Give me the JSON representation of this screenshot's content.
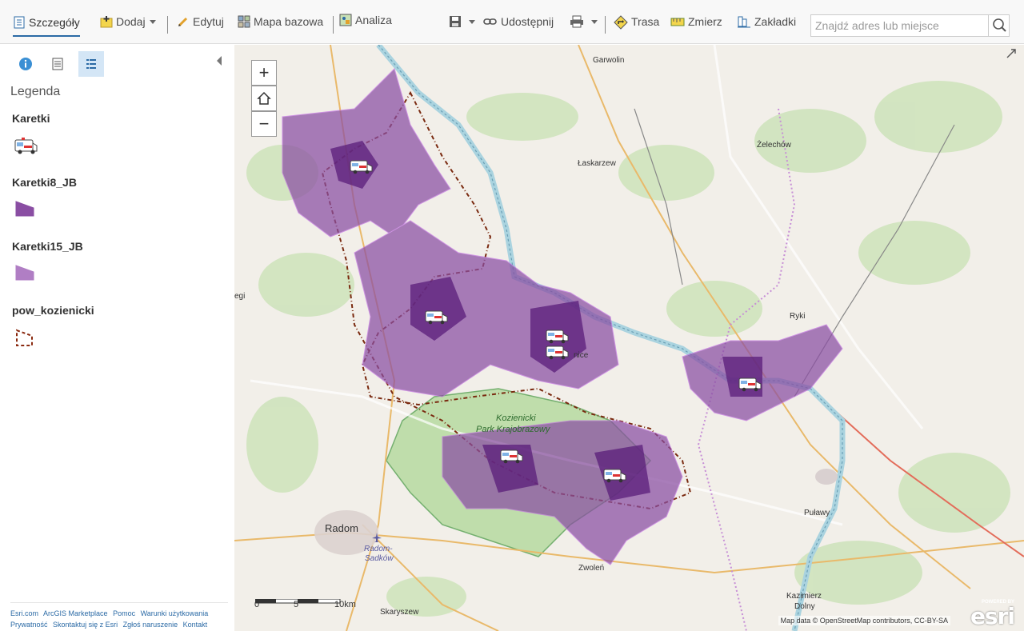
{
  "toolbar": {
    "details": "Szczegóły",
    "add": "Dodaj",
    "edit": "Edytuj",
    "basemap": "Mapa bazowa",
    "analysis": "Analiza",
    "share": "Udostępnij",
    "route": "Trasa",
    "measure": "Zmierz",
    "bookmarks": "Zakładki",
    "search_placeholder": "Znajdź adres lub miejsce"
  },
  "sidebar": {
    "legend_title": "Legenda",
    "layers": [
      "Karetki",
      "Karetki8_JB",
      "Karetki15_JB",
      "pow_kozienicki"
    ],
    "footer": [
      "Esri.com",
      "ArcGIS Marketplace",
      "Pomoc",
      "Warunki użytkowania",
      "Prywatność",
      "Skontaktuj się z Esri",
      "Zgłoś naruszenie",
      "Kontakt"
    ]
  },
  "map": {
    "places": [
      "Garwolin",
      "Łaskarzew",
      "Żelechów",
      "Ryki",
      "Kozienicki",
      "Park Krajobrazowy",
      "Radom",
      "Radom-",
      "Sadków",
      "Zwoleń",
      "Puławy",
      "Kazimierz",
      "Dolny",
      "Skaryszew",
      "egi",
      "nice"
    ],
    "scale_labels": [
      "0",
      "5",
      "10km"
    ],
    "attribution": "Map data © OpenStreetMap contributors, CC-BY-SA",
    "esri_powered": "POWERED BY",
    "esri_logo": "esri",
    "zoom_in": "+",
    "zoom_out": "−"
  },
  "colors": {
    "accent": "#2b6aa5",
    "polygon8": "#5a1e7a",
    "polygon15": "#8a4ea3",
    "park": "#b7dba1",
    "river": "#aad3df"
  }
}
